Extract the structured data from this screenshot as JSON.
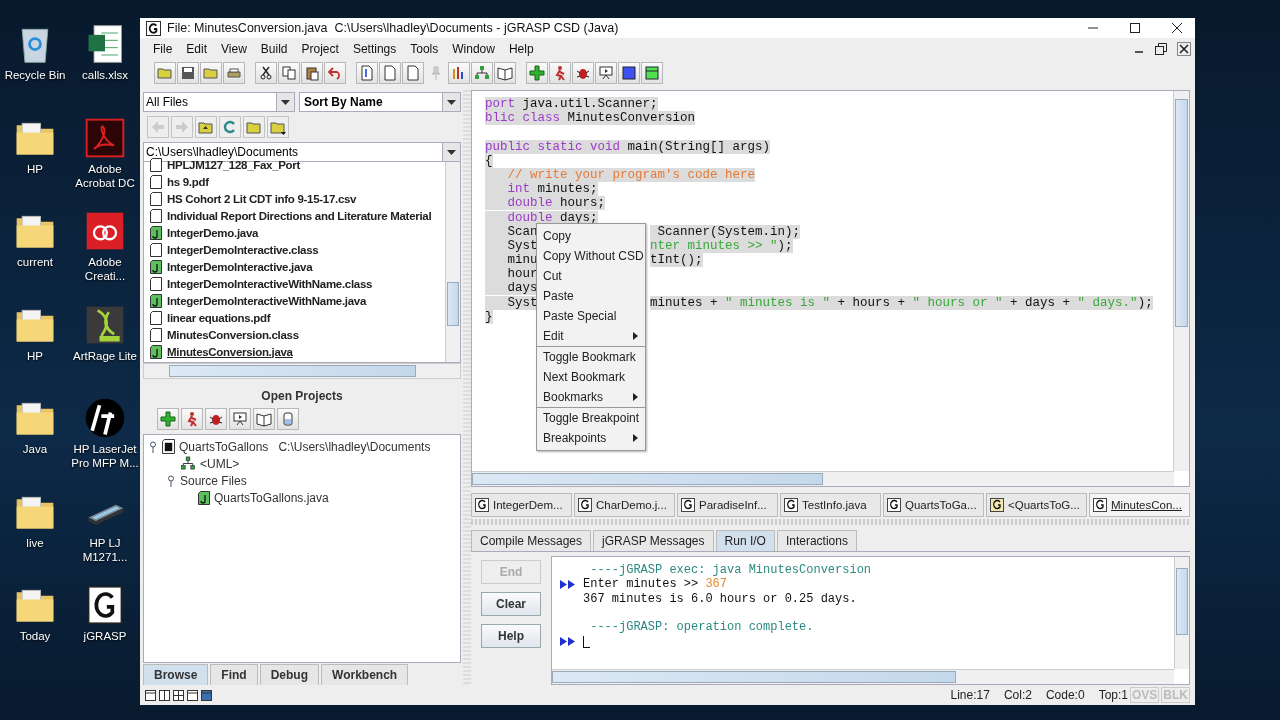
{
  "desktop": {
    "icons": [
      {
        "label": "Recycle Bin",
        "kind": "recycle"
      },
      {
        "label": "calls.xlsx",
        "kind": "spreadsheet"
      },
      {
        "label": "HP",
        "kind": "folder"
      },
      {
        "label": "Adobe Acrobat DC",
        "kind": "pdf"
      },
      {
        "label": "current",
        "kind": "folder"
      },
      {
        "label": "Adobe Creati...",
        "kind": "cloud"
      },
      {
        "label": "HP",
        "kind": "folder"
      },
      {
        "label": "ArtRage Lite",
        "kind": "art"
      },
      {
        "label": "Java",
        "kind": "folder"
      },
      {
        "label": "HP LaserJet Pro MFP M...",
        "kind": "hp"
      },
      {
        "label": "live",
        "kind": "folder"
      },
      {
        "label": "HP LJ M1271...",
        "kind": "scanner"
      },
      {
        "label": "Today",
        "kind": "folder"
      },
      {
        "label": "jGRASP",
        "kind": "g"
      }
    ]
  },
  "window": {
    "title": "File: MinutesConversion.java  C:\\Users\\lhadley\\Documents - jGRASP CSD (Java)"
  },
  "menu": [
    "File",
    "Edit",
    "View",
    "Build",
    "Project",
    "Settings",
    "Tools",
    "Window",
    "Help"
  ],
  "browser": {
    "filter": "All Files",
    "sort": "Sort By Name",
    "path": "C:\\Users\\lhadley\\Documents",
    "files": [
      {
        "name": "HPLJM127_128_Fax_Port",
        "kind": "file",
        "selected": false
      },
      {
        "name": "hs 9.pdf",
        "kind": "file",
        "selected": false
      },
      {
        "name": "HS Cohort 2 Lit CDT info 9-15-17.csv",
        "kind": "file",
        "selected": false
      },
      {
        "name": "Individual Report Directions and Literature Material",
        "kind": "file",
        "selected": false
      },
      {
        "name": "IntegerDemo.java",
        "kind": "java",
        "selected": false
      },
      {
        "name": "IntegerDemoInteractive.class",
        "kind": "file",
        "selected": false
      },
      {
        "name": "IntegerDemoInteractive.java",
        "kind": "java",
        "selected": false
      },
      {
        "name": "IntegerDemoInteractiveWithName.class",
        "kind": "file",
        "selected": false
      },
      {
        "name": "IntegerDemoInteractiveWithName.java",
        "kind": "java",
        "selected": false
      },
      {
        "name": "linear equations.pdf",
        "kind": "file",
        "selected": false
      },
      {
        "name": "MinutesConversion.class",
        "kind": "file",
        "selected": false
      },
      {
        "name": "MinutesConversion.java",
        "kind": "java",
        "selected": true
      }
    ]
  },
  "projects": {
    "title": "Open Projects",
    "tree": [
      {
        "label": "QuartsToGallons",
        "path": "C:\\Users\\lhadley\\Documents",
        "kind": "project",
        "expanded": true,
        "children": [
          {
            "label": "<UML>",
            "kind": "uml"
          },
          {
            "label": "Source Files",
            "kind": "folder",
            "expanded": true,
            "children": [
              {
                "label": "QuartsToGallons.java",
                "kind": "java"
              }
            ]
          }
        ]
      }
    ]
  },
  "left_tabs": [
    {
      "label": "Browse",
      "selected": true
    },
    {
      "label": "Find",
      "selected": false
    },
    {
      "label": "Debug",
      "selected": false
    },
    {
      "label": "Workbench",
      "selected": false
    }
  ],
  "editor": {
    "lines": [
      {
        "kind": "code",
        "left": [
          {
            "text": "port",
            "kind": "keyword"
          },
          {
            "text": " java.util.Scanner;",
            "kind": "plain"
          }
        ]
      },
      {
        "kind": "code",
        "left": [
          {
            "text": "blic class",
            "kind": "keyword"
          },
          {
            "text": " MinutesConversion",
            "kind": "plain"
          }
        ]
      },
      {
        "kind": "blank"
      },
      {
        "kind": "code",
        "left": [
          {
            "text": "public static void",
            "kind": "keyword"
          },
          {
            "text": " main(String[] args)",
            "kind": "plain"
          }
        ]
      },
      {
        "kind": "code",
        "left": [
          {
            "text": "{",
            "kind": "plain"
          }
        ]
      },
      {
        "kind": "code",
        "left": [
          {
            "text": "   // write your program's code here",
            "kind": "comment"
          }
        ]
      },
      {
        "kind": "code",
        "left": [
          {
            "text": "   int",
            "kind": "keyword"
          },
          {
            "text": " minutes;",
            "kind": "plain"
          }
        ]
      },
      {
        "kind": "code",
        "left": [
          {
            "text": "   double",
            "kind": "keyword"
          },
          {
            "text": " hours;",
            "kind": "plain"
          }
        ]
      },
      {
        "kind": "code",
        "left": [
          {
            "text": "   double",
            "kind": "keyword"
          },
          {
            "text": " days;",
            "kind": "plain"
          }
        ]
      },
      {
        "kind": "code",
        "left": [
          {
            "text": "   Scan",
            "kind": "plain"
          }
        ],
        "right": [
          {
            "text": " Scanner(System.in);",
            "kind": "plain"
          }
        ]
      },
      {
        "kind": "code",
        "left": [
          {
            "text": "   Syst",
            "kind": "plain"
          }
        ],
        "right": [
          {
            "text": "nter minutes >> \"",
            "kind": "string"
          },
          {
            "text": ");",
            "kind": "plain"
          }
        ]
      },
      {
        "kind": "code",
        "left": [
          {
            "text": "   minu",
            "kind": "plain"
          }
        ],
        "right": [
          {
            "text": "tInt();",
            "kind": "plain"
          }
        ]
      },
      {
        "kind": "code",
        "left": [
          {
            "text": "   hour",
            "kind": "plain"
          }
        ]
      },
      {
        "kind": "code",
        "left": [
          {
            "text": "   days",
            "kind": "plain"
          }
        ]
      },
      {
        "kind": "code",
        "left": [
          {
            "text": "   Syst",
            "kind": "plain"
          }
        ],
        "right": [
          {
            "text": "minutes + ",
            "kind": "plain"
          },
          {
            "text": "\" minutes is \"",
            "kind": "string"
          },
          {
            "text": " + hours + ",
            "kind": "plain"
          },
          {
            "text": "\" hours or \"",
            "kind": "string"
          },
          {
            "text": " + days + ",
            "kind": "plain"
          },
          {
            "text": "\" days.\"",
            "kind": "string"
          },
          {
            "text": ");",
            "kind": "plain"
          }
        ]
      },
      {
        "kind": "code",
        "left": [
          {
            "text": "}",
            "kind": "plain"
          }
        ]
      }
    ],
    "context_menu": [
      {
        "kind": "item",
        "label": "Copy",
        "submenu": false
      },
      {
        "kind": "item",
        "label": "Copy Without CSD",
        "submenu": false
      },
      {
        "kind": "item",
        "label": "Cut",
        "submenu": false
      },
      {
        "kind": "item",
        "label": "Paste",
        "submenu": false
      },
      {
        "kind": "item",
        "label": "Paste Special",
        "submenu": false
      },
      {
        "kind": "item",
        "label": "Edit",
        "submenu": true
      },
      {
        "kind": "separator"
      },
      {
        "kind": "item",
        "label": "Toggle Bookmark",
        "submenu": false
      },
      {
        "kind": "item",
        "label": "Next Bookmark",
        "submenu": false
      },
      {
        "kind": "item",
        "label": "Bookmarks",
        "submenu": true
      },
      {
        "kind": "separator"
      },
      {
        "kind": "item",
        "label": "Toggle Breakpoint",
        "submenu": false
      },
      {
        "kind": "item",
        "label": "Breakpoints",
        "submenu": true
      }
    ]
  },
  "doc_tabs": [
    {
      "label": "IntegerDem...",
      "kind": "csd",
      "selected": false
    },
    {
      "label": "CharDemo.j...",
      "kind": "csd",
      "selected": false
    },
    {
      "label": "ParadiseInf...",
      "kind": "csd",
      "selected": false
    },
    {
      "label": "TestInfo.java",
      "kind": "csd",
      "selected": false
    },
    {
      "label": "QuartsToGa...",
      "kind": "csd",
      "selected": false
    },
    {
      "label": "<QuartsToG...",
      "kind": "uml",
      "selected": false
    },
    {
      "label": "MinutesCon...",
      "kind": "csd",
      "selected": true
    }
  ],
  "message_tabs": [
    {
      "label": "Compile Messages",
      "selected": false
    },
    {
      "label": "jGRASP Messages",
      "selected": false
    },
    {
      "label": "Run I/O",
      "selected": true
    },
    {
      "label": "Interactions",
      "selected": false
    }
  ],
  "run_buttons": [
    {
      "label": "End",
      "disabled": true
    },
    {
      "label": "Clear",
      "disabled": false
    },
    {
      "label": "Help",
      "disabled": false
    }
  ],
  "run_io": {
    "lines": [
      {
        "kind": "system",
        "text": " ----jGRASP exec: java MinutesConversion",
        "arrow": false
      },
      {
        "kind": "output",
        "text": "Enter minutes >> ",
        "input": "367",
        "arrow": true
      },
      {
        "kind": "output",
        "text": "367 minutes is 6.0 hours or 0.25 days.",
        "arrow": false
      },
      {
        "kind": "blank",
        "arrow": false
      },
      {
        "kind": "system",
        "text": " ----jGRASP: operation complete.",
        "arrow": false
      },
      {
        "kind": "prompt",
        "arrow": true
      }
    ]
  },
  "status_bar": {
    "fields": [
      "Line:17",
      "Col:2",
      "Code:0",
      "Top:1"
    ],
    "modes": [
      {
        "label": "OVS",
        "on": false
      },
      {
        "label": "BLK",
        "on": false
      }
    ]
  }
}
